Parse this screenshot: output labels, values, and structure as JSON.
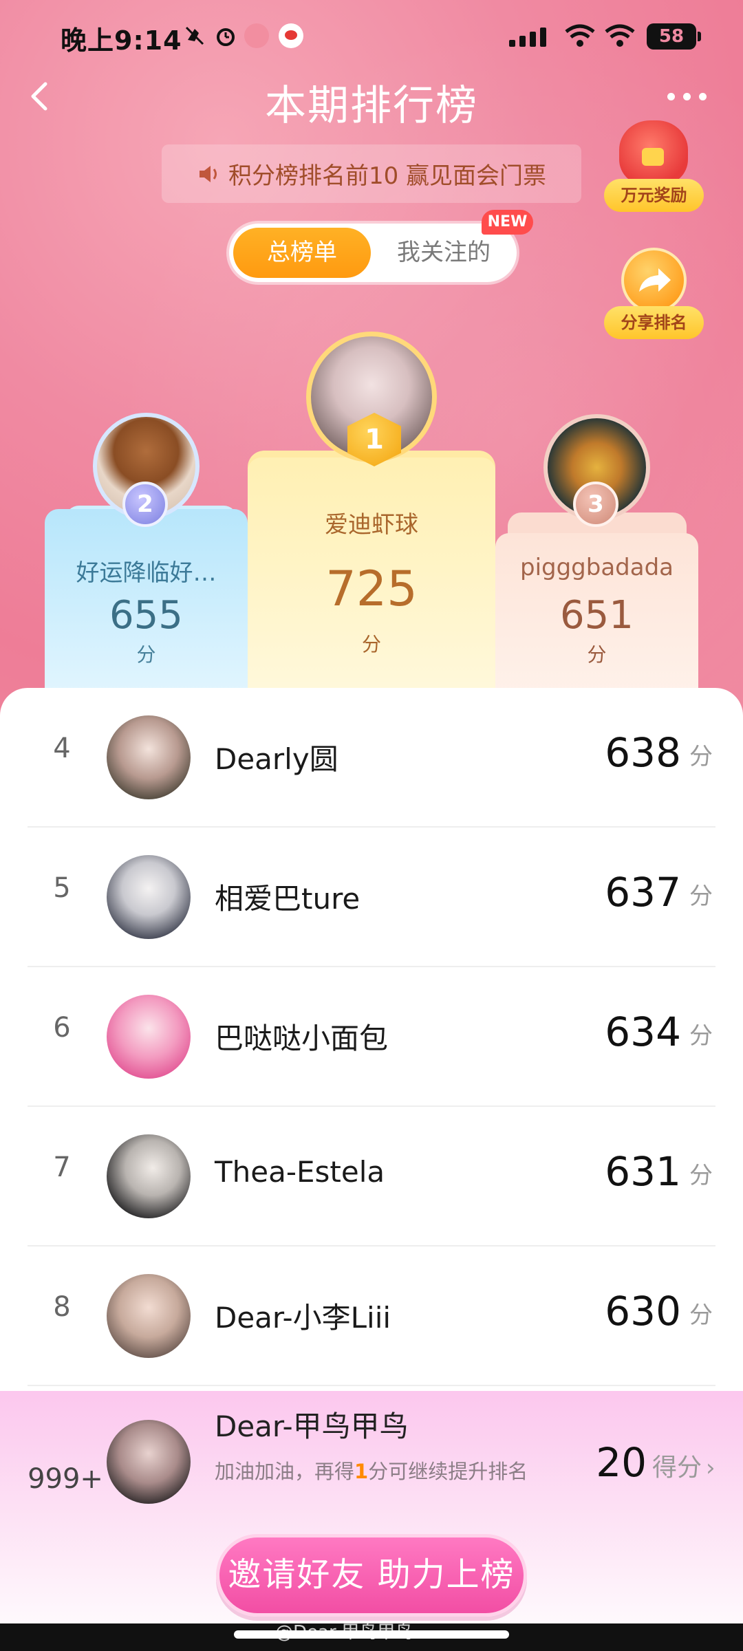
{
  "status_bar": {
    "time": "晚上9:14",
    "battery": "58",
    "icons": [
      "mute-icon",
      "alarm-icon",
      "app-pig-icon",
      "weibo-icon",
      "signal-icon",
      "wifi-icon",
      "wifi-icon",
      "battery-icon"
    ]
  },
  "header": {
    "title": "本期排行榜",
    "back_icon": "chevron-left-icon",
    "more_icon": "more-dots-icon"
  },
  "announcement": {
    "text": "积分榜排名前10 赢见面会门票",
    "icon": "speaker-icon"
  },
  "floating": {
    "reward_label": "万元奖励",
    "share_label": "分享排名"
  },
  "tabs": [
    {
      "label": "总榜单",
      "active": true
    },
    {
      "label": "我关注的",
      "active": false
    }
  ],
  "new_badge": "NEW",
  "podium": [
    {
      "rank": "2",
      "name": "好运降临好…",
      "score": "655",
      "unit": "分"
    },
    {
      "rank": "1",
      "name": "爱迪虾球",
      "score": "725",
      "unit": "分"
    },
    {
      "rank": "3",
      "name": "pigggbadada",
      "score": "651",
      "unit": "分"
    }
  ],
  "list": [
    {
      "rank": "4",
      "name": "Dearly圆",
      "score": "638",
      "unit": "分"
    },
    {
      "rank": "5",
      "name": "相爱巴ture",
      "score": "637",
      "unit": "分"
    },
    {
      "rank": "6",
      "name": "巴哒哒小面包",
      "score": "634",
      "unit": "分"
    },
    {
      "rank": "7",
      "name": "Thea-Estela",
      "score": "631",
      "unit": "分"
    },
    {
      "rank": "8",
      "name": "Dear-小李Liii",
      "score": "630",
      "unit": "分"
    }
  ],
  "me": {
    "rank": "999+",
    "name": "Dear-甲鸟甲鸟",
    "hint_prefix": "加油加油，再得",
    "hint_highlight": "1",
    "hint_suffix": "分可继续提升排名",
    "score": "20",
    "unit": "得分",
    "chevron": "›"
  },
  "invite_button": "邀请好友 助力上榜",
  "watermark": "@Dear-甲鸟甲鸟",
  "colors": {
    "accent_orange": "#ff9a10",
    "pink_bg": "#f08aa2",
    "invite_pink": "#f24ea4",
    "highlight": "#ff8a00"
  }
}
